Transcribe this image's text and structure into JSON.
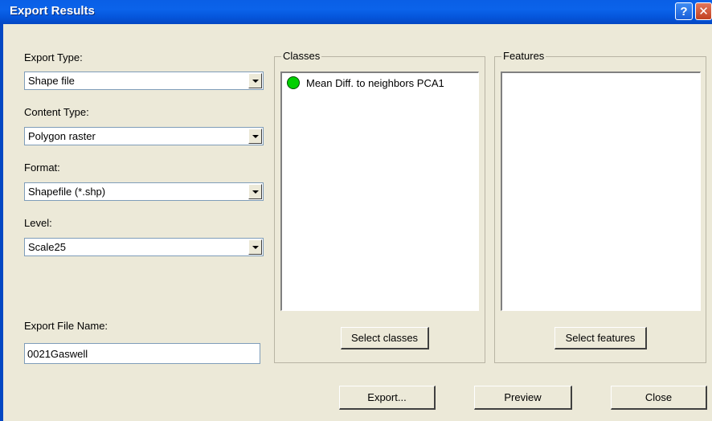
{
  "window": {
    "title": "Export Results",
    "help_glyph": "?",
    "close_glyph": "✕"
  },
  "form": {
    "export_type_label": "Export Type:",
    "export_type_value": "Shape file",
    "content_type_label": "Content Type:",
    "content_type_value": "Polygon raster",
    "format_label": "Format:",
    "format_value": "Shapefile (*.shp)",
    "level_label": "Level:",
    "level_value": "Scale25",
    "file_name_label": "Export File Name:",
    "file_name_value": "0021Gaswell"
  },
  "classes": {
    "title": "Classes",
    "items": [
      {
        "label": "Mean Diff. to neighbors PCA1",
        "color": "#00d000"
      }
    ],
    "select_button": "Select classes"
  },
  "features": {
    "title": "Features",
    "select_button": "Select features"
  },
  "actions": {
    "export": "Export...",
    "preview": "Preview",
    "close": "Close"
  }
}
